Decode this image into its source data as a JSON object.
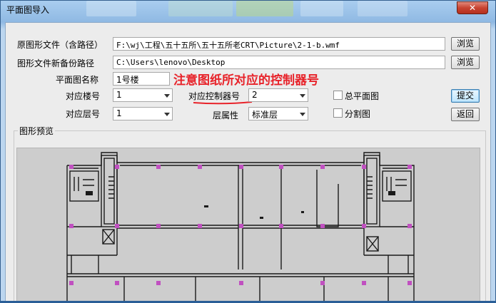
{
  "window": {
    "title": "平面图导入",
    "close_label": "✕"
  },
  "form": {
    "original_path_label": "原图形文件（含路径）",
    "original_path_value": "F:\\wj\\工程\\五十五所\\五十五所老CRT\\Picture\\2-1-b.wmf",
    "backup_path_label": "图形文件新备份路径",
    "backup_path_value": "C:\\Users\\lenovo\\Desktop",
    "plan_name_label": "平面图名称",
    "plan_name_value": "1号楼",
    "building_label": "对应楼号",
    "building_value": "1",
    "floor_label": "对应层号",
    "floor_value": "1",
    "controller_label": "对应控制器号",
    "controller_value": "2",
    "layer_attr_label": "层属性",
    "layer_attr_value": "标准层",
    "master_plan_label": "总平面图",
    "split_plan_label": "分割图"
  },
  "buttons": {
    "browse1": "浏览",
    "browse2": "浏览",
    "submit": "提交",
    "back": "返回"
  },
  "annotation": {
    "text": "注意图纸所对应的控制器号",
    "color": "#e8232a"
  },
  "preview": {
    "group_title": "图形预览"
  },
  "colors": {
    "marker": "#c050c0",
    "wall": "#1a1a1a",
    "preview_bg": "#cdcdcd"
  }
}
